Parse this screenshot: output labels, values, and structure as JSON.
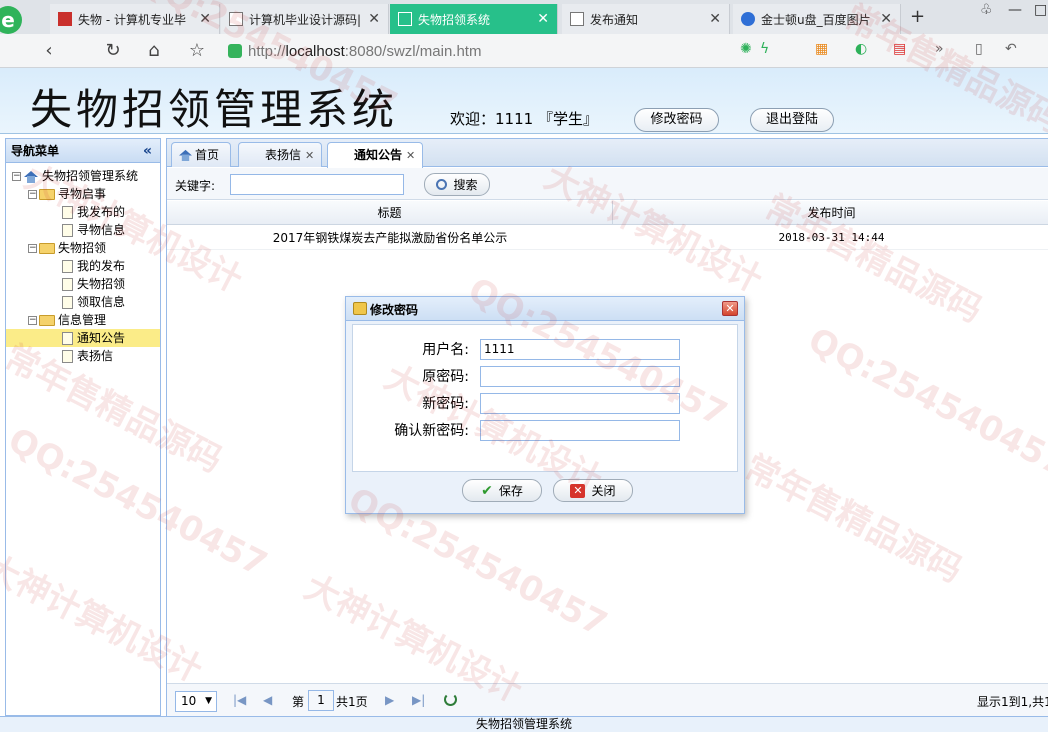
{
  "browser": {
    "tabs": [
      {
        "title": "失物 - 计算机专业毕",
        "active": false
      },
      {
        "title": "计算机毕业设计源码|",
        "active": false
      },
      {
        "title": "失物招领系统",
        "active": true
      },
      {
        "title": "发布通知",
        "active": false
      },
      {
        "title": "金士顿u盘_百度图片",
        "active": false
      }
    ],
    "new_tab": "+",
    "url_prefix": "http://",
    "url_host": "localhost",
    "url_rest": ":8080/swzl/main.htm",
    "more_label": "»"
  },
  "header": {
    "title": "失物招领管理系统",
    "welcome": "欢迎：1111 『学生』",
    "change_password": "修改密码",
    "logout": "退出登陆"
  },
  "nav": {
    "title": "导航菜单",
    "collapse": "«",
    "root": "失物招领管理系统",
    "groups": [
      {
        "label": "寻物启事",
        "items": [
          "我发布的",
          "寻物信息"
        ]
      },
      {
        "label": "失物招领",
        "items": [
          "我的发布",
          "失物招领",
          "领取信息"
        ]
      },
      {
        "label": "信息管理",
        "items": [
          "通知公告",
          "表扬信"
        ]
      }
    ],
    "selected": "通知公告"
  },
  "panel_tabs": [
    {
      "label": "首页",
      "closable": false,
      "active": false
    },
    {
      "label": "表扬信",
      "closable": true,
      "active": false
    },
    {
      "label": "通知公告",
      "closable": true,
      "active": true
    }
  ],
  "search": {
    "label": "关键字:",
    "value": "",
    "button": "搜索"
  },
  "grid": {
    "columns": [
      "标题",
      "发布时间"
    ],
    "rows": [
      [
        "2017年钢铁煤炭去产能拟激励省份名单公示",
        "2018-03-31 14:44"
      ]
    ]
  },
  "pager": {
    "page_size": "10",
    "page_label": "第",
    "page_number": "1",
    "total_label": "共1页",
    "info": "显示1到1,共1"
  },
  "dialog": {
    "title": "修改密码",
    "close": "✕",
    "fields": [
      {
        "label": "用户名:",
        "value": "1111"
      },
      {
        "label": "原密码:",
        "value": ""
      },
      {
        "label": "新密码:",
        "value": ""
      },
      {
        "label": "确认新密码:",
        "value": ""
      }
    ],
    "save": "保存",
    "cancel": "关闭"
  },
  "footer": "失物招领管理系统",
  "colors": {
    "accent_tab": "#27c08a",
    "panel_border": "#99bbe8",
    "selected_node": "#fbec88"
  },
  "watermark": [
    "QQ:254540457",
    "大神计算机设计",
    "常年售精品源码",
    "QQ:254540457",
    "大神计算机设计",
    "常年售精品源码",
    "QQ:254540457",
    "大神计算机设计",
    "常年售精品源码",
    "QQ:254540457",
    "大神计算机设计",
    "常年售精品源码",
    "QQ:254540457",
    "大神计算机设计"
  ]
}
